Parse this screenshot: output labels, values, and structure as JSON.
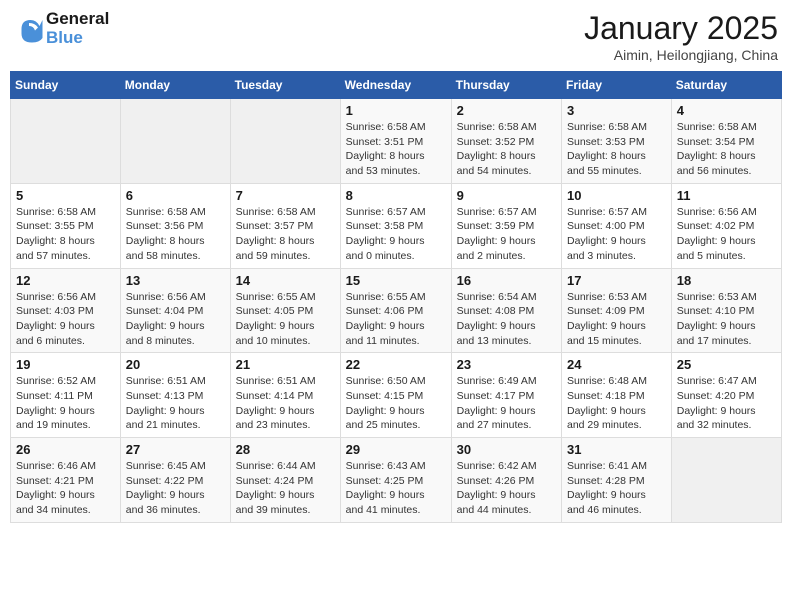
{
  "header": {
    "logo_line1": "General",
    "logo_line2": "Blue",
    "month_title": "January 2025",
    "location": "Aimin, Heilongjiang, China"
  },
  "weekdays": [
    "Sunday",
    "Monday",
    "Tuesday",
    "Wednesday",
    "Thursday",
    "Friday",
    "Saturday"
  ],
  "weeks": [
    [
      {
        "day": "",
        "info": ""
      },
      {
        "day": "",
        "info": ""
      },
      {
        "day": "",
        "info": ""
      },
      {
        "day": "1",
        "info": "Sunrise: 6:58 AM\nSunset: 3:51 PM\nDaylight: 8 hours\nand 53 minutes."
      },
      {
        "day": "2",
        "info": "Sunrise: 6:58 AM\nSunset: 3:52 PM\nDaylight: 8 hours\nand 54 minutes."
      },
      {
        "day": "3",
        "info": "Sunrise: 6:58 AM\nSunset: 3:53 PM\nDaylight: 8 hours\nand 55 minutes."
      },
      {
        "day": "4",
        "info": "Sunrise: 6:58 AM\nSunset: 3:54 PM\nDaylight: 8 hours\nand 56 minutes."
      }
    ],
    [
      {
        "day": "5",
        "info": "Sunrise: 6:58 AM\nSunset: 3:55 PM\nDaylight: 8 hours\nand 57 minutes."
      },
      {
        "day": "6",
        "info": "Sunrise: 6:58 AM\nSunset: 3:56 PM\nDaylight: 8 hours\nand 58 minutes."
      },
      {
        "day": "7",
        "info": "Sunrise: 6:58 AM\nSunset: 3:57 PM\nDaylight: 8 hours\nand 59 minutes."
      },
      {
        "day": "8",
        "info": "Sunrise: 6:57 AM\nSunset: 3:58 PM\nDaylight: 9 hours\nand 0 minutes."
      },
      {
        "day": "9",
        "info": "Sunrise: 6:57 AM\nSunset: 3:59 PM\nDaylight: 9 hours\nand 2 minutes."
      },
      {
        "day": "10",
        "info": "Sunrise: 6:57 AM\nSunset: 4:00 PM\nDaylight: 9 hours\nand 3 minutes."
      },
      {
        "day": "11",
        "info": "Sunrise: 6:56 AM\nSunset: 4:02 PM\nDaylight: 9 hours\nand 5 minutes."
      }
    ],
    [
      {
        "day": "12",
        "info": "Sunrise: 6:56 AM\nSunset: 4:03 PM\nDaylight: 9 hours\nand 6 minutes."
      },
      {
        "day": "13",
        "info": "Sunrise: 6:56 AM\nSunset: 4:04 PM\nDaylight: 9 hours\nand 8 minutes."
      },
      {
        "day": "14",
        "info": "Sunrise: 6:55 AM\nSunset: 4:05 PM\nDaylight: 9 hours\nand 10 minutes."
      },
      {
        "day": "15",
        "info": "Sunrise: 6:55 AM\nSunset: 4:06 PM\nDaylight: 9 hours\nand 11 minutes."
      },
      {
        "day": "16",
        "info": "Sunrise: 6:54 AM\nSunset: 4:08 PM\nDaylight: 9 hours\nand 13 minutes."
      },
      {
        "day": "17",
        "info": "Sunrise: 6:53 AM\nSunset: 4:09 PM\nDaylight: 9 hours\nand 15 minutes."
      },
      {
        "day": "18",
        "info": "Sunrise: 6:53 AM\nSunset: 4:10 PM\nDaylight: 9 hours\nand 17 minutes."
      }
    ],
    [
      {
        "day": "19",
        "info": "Sunrise: 6:52 AM\nSunset: 4:11 PM\nDaylight: 9 hours\nand 19 minutes."
      },
      {
        "day": "20",
        "info": "Sunrise: 6:51 AM\nSunset: 4:13 PM\nDaylight: 9 hours\nand 21 minutes."
      },
      {
        "day": "21",
        "info": "Sunrise: 6:51 AM\nSunset: 4:14 PM\nDaylight: 9 hours\nand 23 minutes."
      },
      {
        "day": "22",
        "info": "Sunrise: 6:50 AM\nSunset: 4:15 PM\nDaylight: 9 hours\nand 25 minutes."
      },
      {
        "day": "23",
        "info": "Sunrise: 6:49 AM\nSunset: 4:17 PM\nDaylight: 9 hours\nand 27 minutes."
      },
      {
        "day": "24",
        "info": "Sunrise: 6:48 AM\nSunset: 4:18 PM\nDaylight: 9 hours\nand 29 minutes."
      },
      {
        "day": "25",
        "info": "Sunrise: 6:47 AM\nSunset: 4:20 PM\nDaylight: 9 hours\nand 32 minutes."
      }
    ],
    [
      {
        "day": "26",
        "info": "Sunrise: 6:46 AM\nSunset: 4:21 PM\nDaylight: 9 hours\nand 34 minutes."
      },
      {
        "day": "27",
        "info": "Sunrise: 6:45 AM\nSunset: 4:22 PM\nDaylight: 9 hours\nand 36 minutes."
      },
      {
        "day": "28",
        "info": "Sunrise: 6:44 AM\nSunset: 4:24 PM\nDaylight: 9 hours\nand 39 minutes."
      },
      {
        "day": "29",
        "info": "Sunrise: 6:43 AM\nSunset: 4:25 PM\nDaylight: 9 hours\nand 41 minutes."
      },
      {
        "day": "30",
        "info": "Sunrise: 6:42 AM\nSunset: 4:26 PM\nDaylight: 9 hours\nand 44 minutes."
      },
      {
        "day": "31",
        "info": "Sunrise: 6:41 AM\nSunset: 4:28 PM\nDaylight: 9 hours\nand 46 minutes."
      },
      {
        "day": "",
        "info": ""
      }
    ]
  ]
}
